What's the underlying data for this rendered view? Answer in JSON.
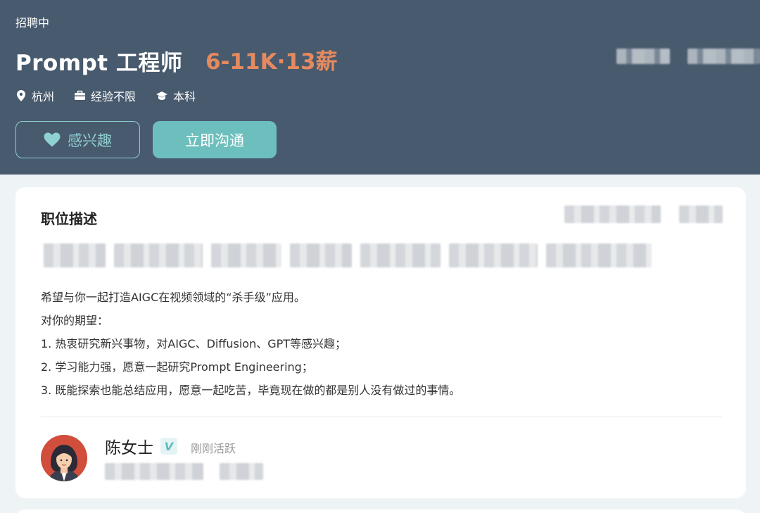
{
  "header": {
    "status": "招聘中",
    "title": "Prompt 工程师",
    "salary": "6-11K·13薪",
    "location": "杭州",
    "experience": "经验不限",
    "education": "本科",
    "interest_label": "感兴趣",
    "chat_label": "立即沟通"
  },
  "card": {
    "title": "职位描述",
    "description": [
      "希望与你一起打造AIGC在视频领域的“杀手级”应用。",
      "对你的期望：",
      "1. 热衷研究新兴事物，对AIGC、Diffusion、GPT等感兴趣；",
      "2. 学习能力强，愿意一起研究Prompt Engineering；",
      "3. 既能探索也能总结应用，愿意一起吃苦，毕竟现在做的都是别人没有做过的事情。"
    ]
  },
  "recruiter": {
    "name": "陈女士",
    "verified_badge": "V",
    "active_status": "刚刚活跃"
  },
  "colors": {
    "header_bg": "#485a6e",
    "salary": "#e58a5f",
    "accent": "#6dbfbd",
    "interest_text": "#8fd0d2"
  },
  "icons": [
    "location-icon",
    "briefcase-icon",
    "graduation-cap-icon",
    "heart-icon"
  ]
}
